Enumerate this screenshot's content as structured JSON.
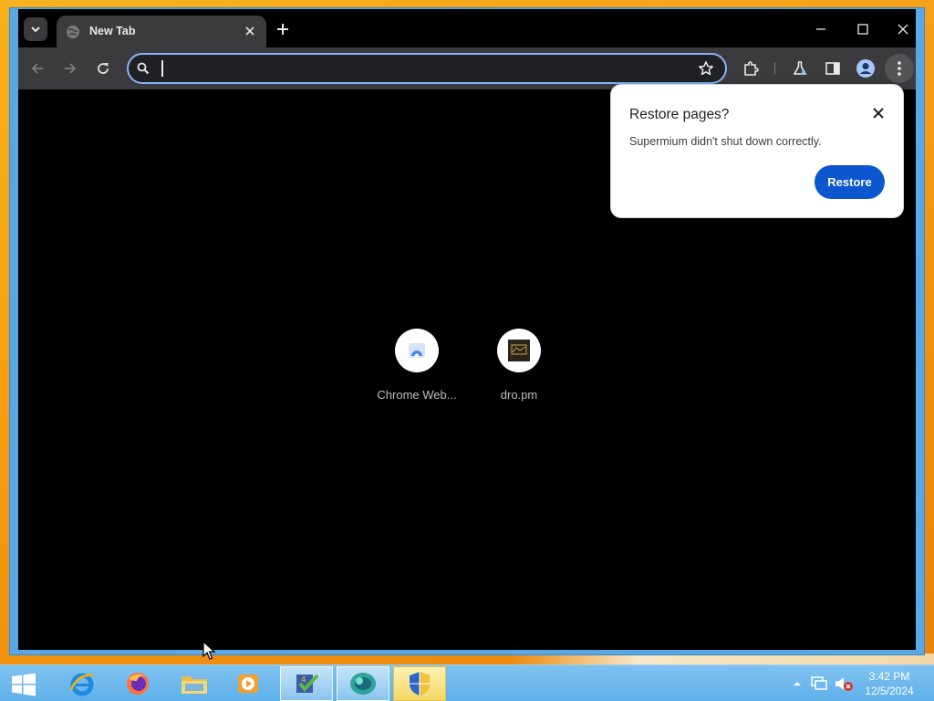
{
  "browser": {
    "tab": {
      "title": "New Tab"
    },
    "omnibox": {
      "value": "",
      "placeholder": ""
    },
    "shortcuts": [
      {
        "label": "Chrome Web..."
      },
      {
        "label": "dro.pm"
      }
    ]
  },
  "restore_bubble": {
    "title": "Restore pages?",
    "message": "Supermium didn't shut down correctly.",
    "button": "Restore"
  },
  "taskbar": {
    "time": "3:42 PM",
    "date": "12/5/2024",
    "apps": [
      "internet-explorer",
      "firefox",
      "file-explorer",
      "media-player",
      "task-app",
      "network-app",
      "security-app"
    ]
  },
  "colors": {
    "accent": "#0b57d0",
    "omnibox_focus": "#8ab4f8",
    "window_frame": "#5aa7e6",
    "toolbar": "#3b3b3d",
    "taskbar": "#6fb9ee",
    "desktop": "#f59a12"
  }
}
